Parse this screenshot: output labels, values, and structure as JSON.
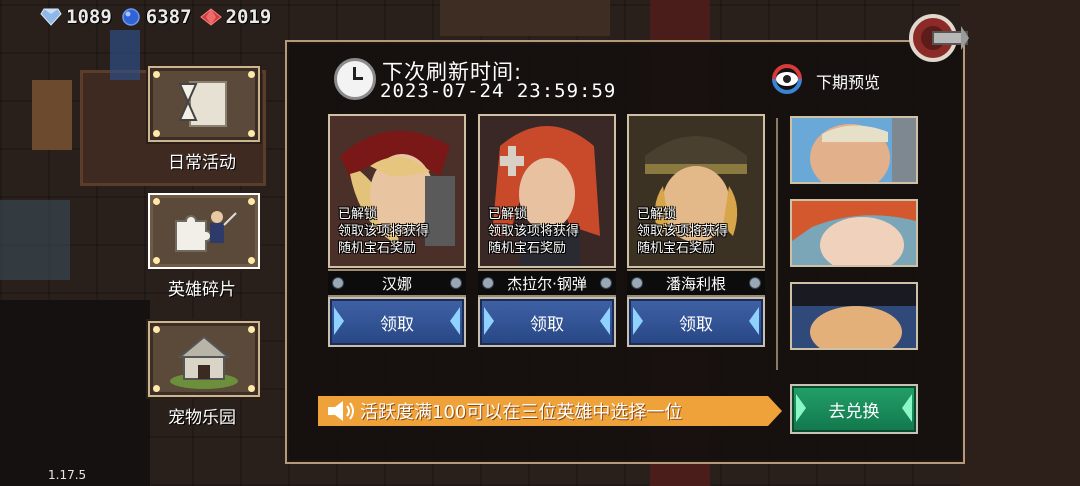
{
  "resources": [
    {
      "icon": "diamond-icon",
      "value": "1089",
      "color": "#8fb8e6"
    },
    {
      "icon": "sapphire-icon",
      "value": "6387",
      "color": "#2f63d6"
    },
    {
      "icon": "ruby-icon",
      "value": "2019",
      "color": "#d83a3a"
    }
  ],
  "sidebar": {
    "items": [
      {
        "label": "日常活动",
        "icon": "scroll-hourglass-icon"
      },
      {
        "label": "英雄碎片",
        "icon": "puzzle-hero-icon"
      },
      {
        "label": "宠物乐园",
        "icon": "pet-house-icon"
      }
    ]
  },
  "panel": {
    "refresh_label": "下次刷新时间:",
    "refresh_time": "2023-07-24 23:59:59",
    "preview_label": "下期预览",
    "cards": [
      {
        "status": "已解锁",
        "line2": "领取该项将获得",
        "line3": "随机宝石奖励",
        "name": "汉娜",
        "button": "领取"
      },
      {
        "status": "已解锁",
        "line2": "领取该项将获得",
        "line3": "随机宝石奖励",
        "name": "杰拉尔·钢弹",
        "button": "领取"
      },
      {
        "status": "已解锁",
        "line2": "领取该项将获得",
        "line3": "随机宝石奖励",
        "name": "潘海利根",
        "button": "领取"
      }
    ],
    "notice": "活跃度满100可以在三位英雄中选择一位",
    "exchange_button": "去兑换"
  },
  "version": "1.17.5",
  "colors": {
    "accent_blue": "#2f4f94",
    "accent_green": "#179060",
    "notice_orange": "#f0a23a",
    "frame_gold": "#cdb592"
  }
}
